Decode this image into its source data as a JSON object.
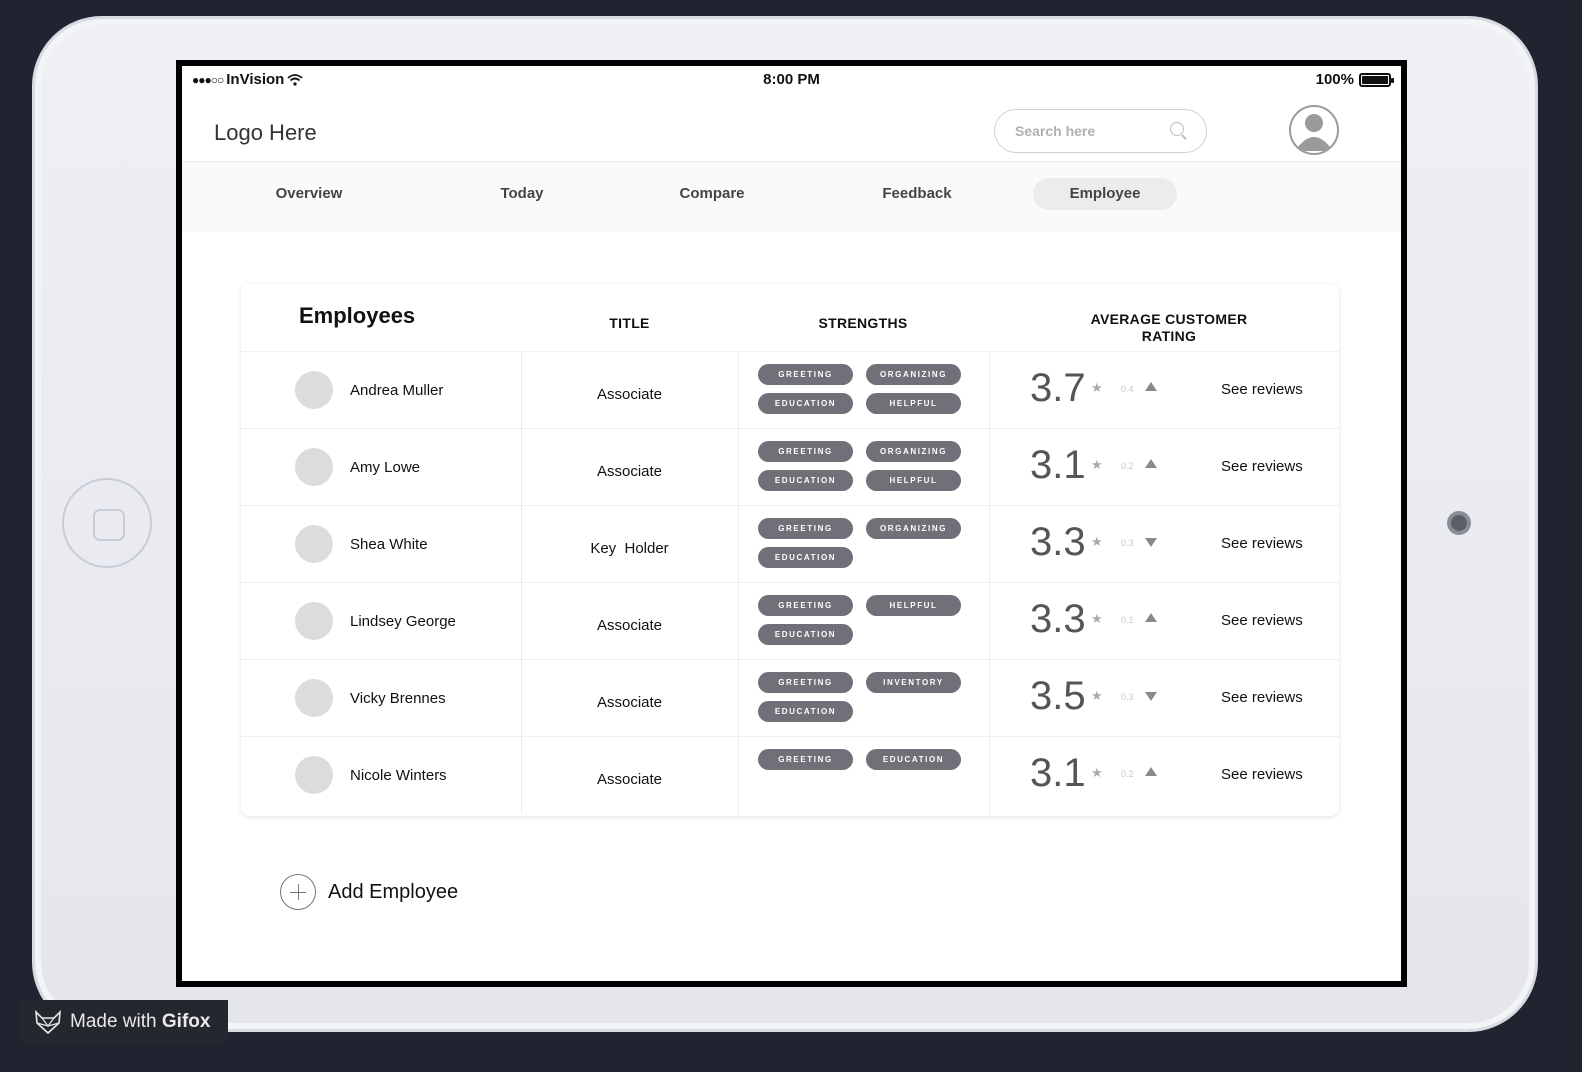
{
  "status_bar": {
    "carrier": "InVision",
    "time": "8:00 PM",
    "battery": "100%"
  },
  "header": {
    "logo": "Logo Here",
    "search_placeholder": "Search here"
  },
  "nav": {
    "tabs": [
      {
        "label": "Overview",
        "active": false
      },
      {
        "label": "Today",
        "active": false
      },
      {
        "label": "Compare",
        "active": false
      },
      {
        "label": "Feedback",
        "active": false
      },
      {
        "label": "Employee",
        "active": true
      }
    ]
  },
  "table": {
    "title": "Employees",
    "columns": {
      "title": "TITLE",
      "strengths": "STRENGTHS",
      "rating_line1": "AVERAGE CUSTOMER",
      "rating_line2": "RATING"
    },
    "rows": [
      {
        "name": "Andrea Muller",
        "title": "Associate",
        "tags": [
          "GREETING",
          "ORGANIZING",
          "EDUCATION",
          "HELPFUL"
        ],
        "rating": "3.7",
        "delta": "0.4",
        "trend": "up",
        "link": "See reviews"
      },
      {
        "name": "Amy Lowe",
        "title": "Associate",
        "tags": [
          "GREETING",
          "ORGANIZING",
          "EDUCATION",
          "HELPFUL"
        ],
        "rating": "3.1",
        "delta": "0.2",
        "trend": "up",
        "link": "See reviews"
      },
      {
        "name": "Shea White",
        "title": "Key  Holder",
        "tags": [
          "GREETING",
          "ORGANIZING",
          "EDUCATION"
        ],
        "rating": "3.3",
        "delta": "0.3",
        "trend": "down",
        "link": "See reviews"
      },
      {
        "name": "Lindsey George",
        "title": "Associate",
        "tags": [
          "GREETING",
          "HELPFUL",
          "EDUCATION"
        ],
        "rating": "3.3",
        "delta": "0.1",
        "trend": "up",
        "link": "See reviews"
      },
      {
        "name": "Vicky Brennes",
        "title": "Associate",
        "tags": [
          "GREETING",
          "INVENTORY",
          "EDUCATION"
        ],
        "rating": "3.5",
        "delta": "0.3",
        "trend": "down",
        "link": "See reviews"
      },
      {
        "name": "Nicole Winters",
        "title": "Associate",
        "tags": [
          "GREETING",
          "EDUCATION"
        ],
        "rating": "3.1",
        "delta": "0.2",
        "trend": "up",
        "link": "See reviews"
      }
    ]
  },
  "add_employee": "Add Employee",
  "watermark": {
    "prefix": "Made with",
    "brand": "Gifox"
  },
  "icons": {
    "star": "star-icon",
    "search": "search-icon",
    "add": "plus-circle-icon",
    "profile": "user-avatar-icon"
  }
}
